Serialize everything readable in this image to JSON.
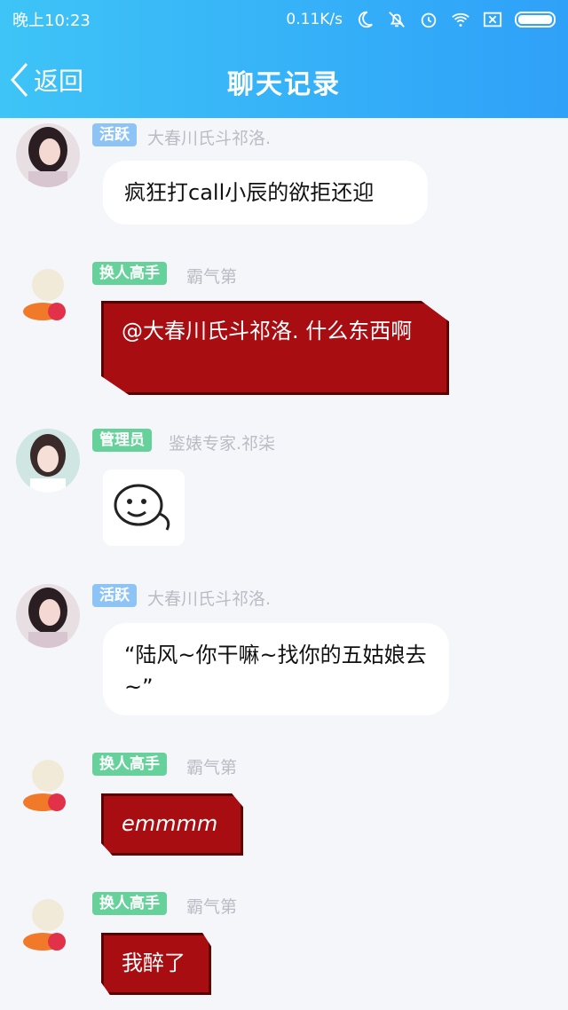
{
  "status_bar": {
    "time": "晚上10:23",
    "net_speed": "0.11K/s"
  },
  "nav": {
    "back_label": "返回",
    "title": "聊天记录"
  },
  "messages": [
    {
      "badge": "活跃",
      "nickname": "大春川氏斗祁洛.",
      "text": "疯狂打call小辰的欲拒还迎",
      "style": "white"
    },
    {
      "badge": "换人高手",
      "nickname": "霸气第",
      "text": "@大春川氏斗祁洛. 什么东西啊",
      "style": "red"
    },
    {
      "badge": "管理员",
      "nickname": "鉴婊专家.祁柒",
      "text": "",
      "style": "sticker"
    },
    {
      "badge": "活跃",
      "nickname": "大春川氏斗祁洛.",
      "text": "“陆风~你干嘛~找你的五姑娘去~”",
      "style": "white"
    },
    {
      "badge": "换人高手",
      "nickname": "霸气第",
      "text": "emmmm",
      "style": "red"
    },
    {
      "badge": "换人高手",
      "nickname": "霸气第",
      "text": "我醉了",
      "style": "red"
    }
  ],
  "colors": {
    "header_start": "#3ec4f7",
    "header_end": "#2fa1f8",
    "badge_active": "#8ec4f5",
    "badge_green": "#67d19b",
    "red_bubble": "#a80d12"
  },
  "icons": [
    "back-arrow-icon",
    "moon-icon",
    "bell-off-icon",
    "alarm-icon",
    "wifi-icon",
    "sim-off-icon",
    "battery-icon"
  ]
}
